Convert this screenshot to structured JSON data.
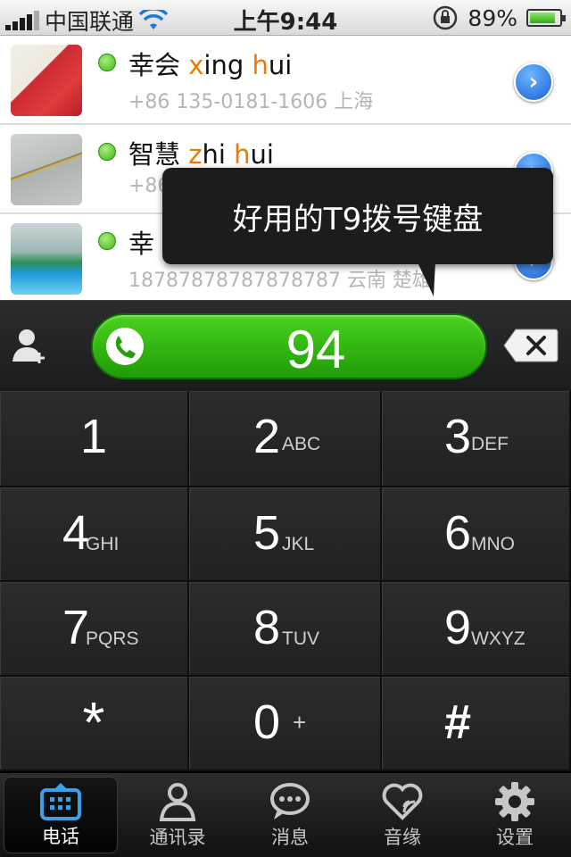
{
  "status_bar": {
    "carrier": "中国联通",
    "time": "上午9:44",
    "battery": "89%"
  },
  "contacts": [
    {
      "name": "幸会",
      "pinyin": [
        {
          "t": "x",
          "h": true
        },
        {
          "t": "ing ",
          "h": false
        },
        {
          "t": "h",
          "h": true
        },
        {
          "t": "ui",
          "h": false
        }
      ],
      "detail": "+86 135-0181-1606 上海"
    },
    {
      "name": "智慧",
      "pinyin": [
        {
          "t": "z",
          "h": true
        },
        {
          "t": "hi ",
          "h": false
        },
        {
          "t": "h",
          "h": true
        },
        {
          "t": "ui",
          "h": false
        }
      ],
      "detail": "+86"
    },
    {
      "name": "幸",
      "pinyin": [],
      "detail": "18787878787878787 云南 楚雄"
    }
  ],
  "tooltip": "好用的T9拨号键盘",
  "dialer": {
    "number": "94"
  },
  "keypad": [
    {
      "num": "1",
      "letters": ""
    },
    {
      "num": "2",
      "letters": "ABC"
    },
    {
      "num": "3",
      "letters": "DEF"
    },
    {
      "num": "4",
      "letters": "GHI"
    },
    {
      "num": "5",
      "letters": "JKL"
    },
    {
      "num": "6",
      "letters": "MNO"
    },
    {
      "num": "7",
      "letters": "PQRS"
    },
    {
      "num": "8",
      "letters": "TUV"
    },
    {
      "num": "9",
      "letters": "WXYZ"
    },
    {
      "num": "*",
      "letters": ""
    },
    {
      "num": "0",
      "letters": "+"
    },
    {
      "num": "#",
      "letters": ""
    }
  ],
  "tabs": [
    {
      "label": "电话",
      "icon": "dialpad-icon",
      "active": true
    },
    {
      "label": "通讯录",
      "icon": "contacts-icon",
      "active": false
    },
    {
      "label": "消息",
      "icon": "message-icon",
      "active": false
    },
    {
      "label": "音缘",
      "icon": "heart-wave-icon",
      "active": false
    },
    {
      "label": "设置",
      "icon": "gear-icon",
      "active": false
    }
  ],
  "colors": {
    "call_green": "#2fb50f",
    "highlight_orange": "#f07800",
    "link_blue": "#1760d6"
  }
}
